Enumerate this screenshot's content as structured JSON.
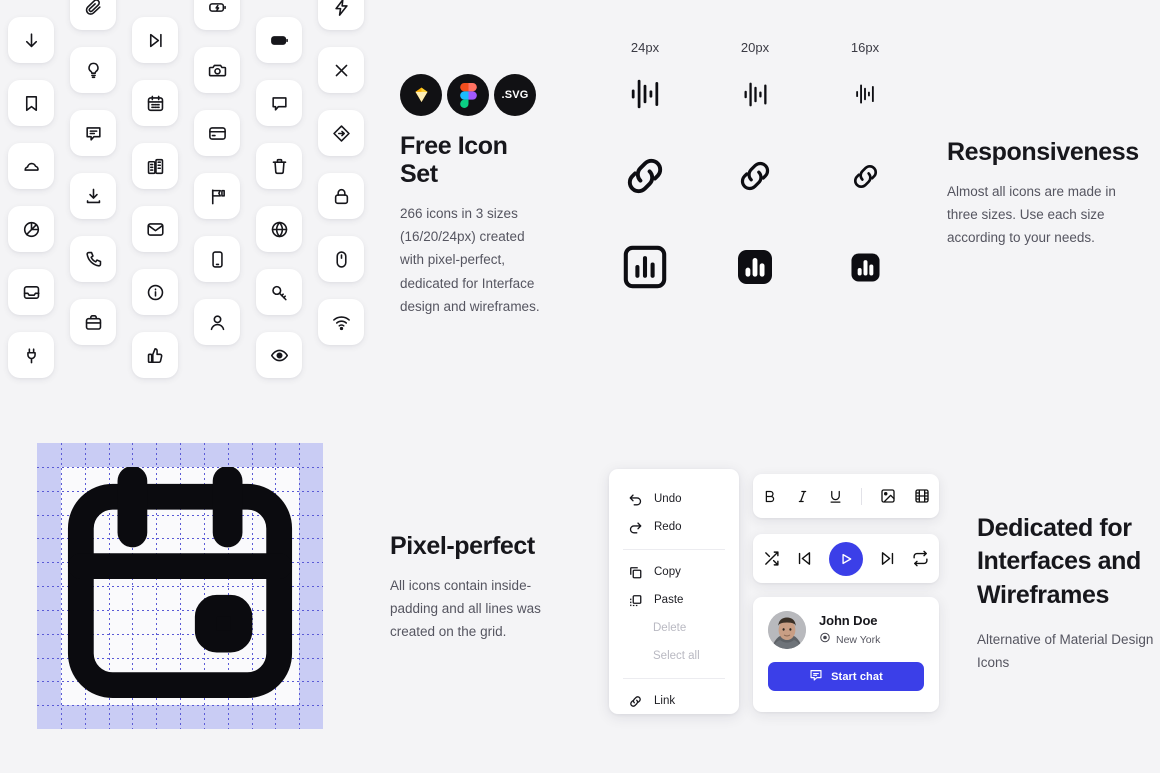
{
  "theme": {
    "bg": "#f4f4f6",
    "chip_bg": "#ffffff",
    "accent_blue": "#3b3fe8",
    "grid_purple": "#c9ccf4",
    "grid_line": "#5b5bd6",
    "heading_color": "#17171c",
    "body_color": "#555560"
  },
  "icon_grid": {
    "columns": [
      {
        "offset": "down",
        "icons": [
          "arrow-down-icon",
          "bookmark-icon",
          "cloud-icon",
          "pie-chart-icon",
          "inbox-icon",
          "plug-icon"
        ]
      },
      {
        "offset": "up",
        "icons": [
          "paperclip-icon",
          "bulb-icon",
          "comment-icon",
          "download-icon",
          "phone-icon",
          "briefcase-icon"
        ]
      },
      {
        "offset": "down",
        "icons": [
          "skip-forward-icon",
          "calendar-icon",
          "buildings-icon",
          "mail-icon",
          "info-icon",
          "thumbs-up-icon"
        ]
      },
      {
        "offset": "up",
        "icons": [
          "battery-charging-icon",
          "camera-icon",
          "credit-card-icon",
          "flag-icon",
          "smartphone-icon",
          "user-icon"
        ]
      },
      {
        "offset": "down",
        "icons": [
          "battery-icon",
          "message-icon",
          "trash-icon",
          "globe-icon",
          "key-icon",
          "eye-icon"
        ]
      },
      {
        "offset": "up",
        "icons": [
          "bolt-icon",
          "close-icon",
          "diamond-arrow-icon",
          "lock-icon",
          "mouse-icon",
          "wifi-icon"
        ]
      }
    ]
  },
  "free_icon_set": {
    "brands": [
      {
        "name": "sketch-logo",
        "label": ""
      },
      {
        "name": "figma-logo",
        "label": ""
      },
      {
        "name": "svg-logo",
        "label": ".SVG"
      }
    ],
    "title": "Free Icon Set",
    "description": "266 icons in 3 sizes (16/20/24px) created with pixel-perfect, dedicated for Interface design and wireframes."
  },
  "sizes": {
    "headers": [
      "24px",
      "20px",
      "16px"
    ],
    "rows": [
      {
        "icon": "audio-waveform-icon",
        "sizes": [
          30,
          25,
          20
        ]
      },
      {
        "icon": "link-icon",
        "sizes": [
          46,
          38,
          31
        ]
      },
      {
        "icon": "bar-chart-box-icon",
        "sizes": [
          48,
          40,
          33
        ]
      }
    ]
  },
  "responsiveness": {
    "title": "Responsiveness",
    "description": "Almost all icons are made in three sizes. Use each size according to your needs."
  },
  "pixel_perfect": {
    "title": "Pixel-perfect",
    "description": "All icons contain inside-padding and all lines was created on the grid.",
    "grid_icon": "calendar-icon",
    "grid_cells": 12,
    "grid_padding_cells": 1
  },
  "context_menu": {
    "groups": [
      [
        {
          "label": "Undo",
          "icon": "undo-icon",
          "disabled": false
        },
        {
          "label": "Redo",
          "icon": "redo-icon",
          "disabled": false
        }
      ],
      [
        {
          "label": "Copy",
          "icon": "copy-icon",
          "disabled": false
        },
        {
          "label": "Paste",
          "icon": "paste-icon",
          "disabled": false
        },
        {
          "label": "Delete",
          "icon": "",
          "disabled": true
        },
        {
          "label": "Select all",
          "icon": "",
          "disabled": true
        }
      ],
      [
        {
          "label": "Link",
          "icon": "link-icon",
          "disabled": false
        }
      ]
    ]
  },
  "format_toolbar": {
    "items": [
      {
        "name": "bold-icon",
        "label": "B"
      },
      {
        "name": "italic-icon",
        "label": "I"
      },
      {
        "name": "underline-icon",
        "label": "U"
      },
      {
        "name": "image-icon",
        "label": ""
      },
      {
        "name": "video-icon",
        "label": ""
      }
    ]
  },
  "media_player": {
    "items": [
      {
        "name": "shuffle-icon"
      },
      {
        "name": "skip-back-icon"
      },
      {
        "name": "play-icon"
      },
      {
        "name": "skip-forward-icon"
      },
      {
        "name": "repeat-icon"
      }
    ]
  },
  "user_card": {
    "avatar": "user-avatar",
    "name": "John Doe",
    "location": "New York",
    "location_icon": "map-pin-icon",
    "button_label": "Start chat",
    "button_icon": "chat-icon"
  },
  "dedicated": {
    "title": "Dedicated for Interfaces and Wireframes",
    "description": "Alternative of Material Design Icons"
  }
}
